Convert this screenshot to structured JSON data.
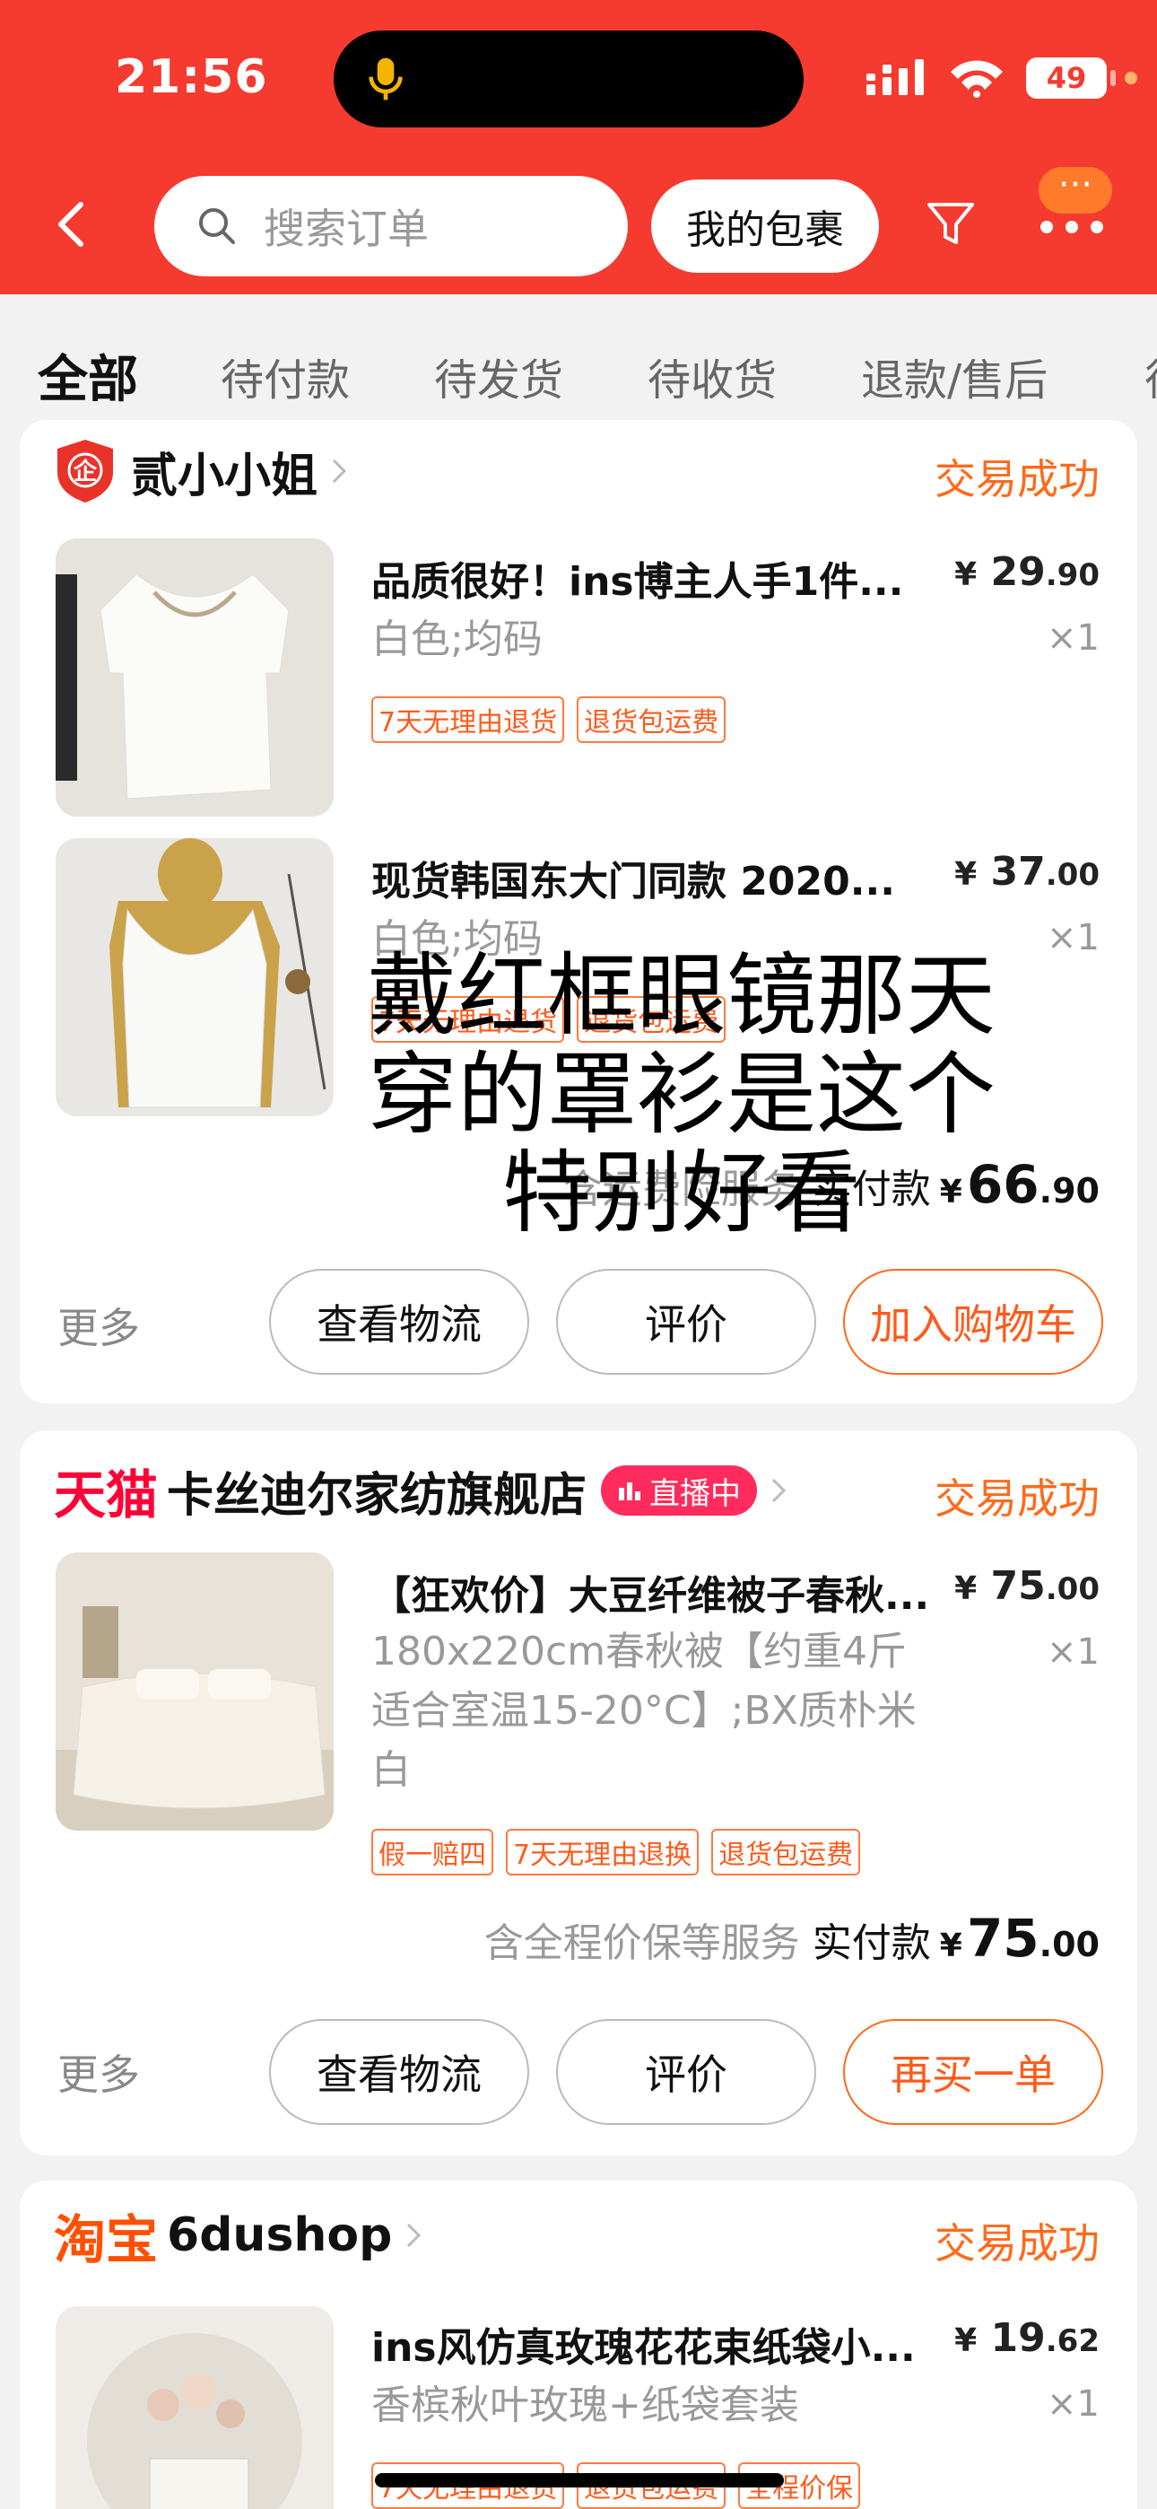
{
  "status_bar": {
    "time": "21:56",
    "battery": "49"
  },
  "header": {
    "search_placeholder": "搜索订单",
    "packages_label": "我的包裹"
  },
  "tabs": [
    "全部",
    "待付款",
    "待发货",
    "待收货",
    "退款/售后",
    "待"
  ],
  "orders": [
    {
      "shop": "贰小小姐",
      "status": "交易成功",
      "items": [
        {
          "title": "品质很好！ins博主人手1件...",
          "price_yen": "¥",
          "price_int": "29",
          "price_dec": ".90",
          "spec": "白色;均码",
          "qty": "×1",
          "tags": [
            "7天无理由退货",
            "退货包运费"
          ]
        },
        {
          "title": "现货韩国东大门同款 2020...",
          "price_yen": "¥",
          "price_int": "37",
          "price_dec": ".00",
          "spec": "白色;均码",
          "qty": "×1",
          "tags": [
            "7天无理由退货",
            "退货包运费"
          ]
        }
      ],
      "service": "含运费险服务",
      "paid_label": "实付款",
      "paid_yen": "¥",
      "paid_int": "66",
      "paid_dec": ".90",
      "more": "更多",
      "buttons": [
        "查看物流",
        "评价",
        "加入购物车"
      ]
    },
    {
      "brand": "天猫",
      "shop": "卡丝迪尔家纺旗舰店",
      "live": "直播中",
      "status": "交易成功",
      "items": [
        {
          "title": "【狂欢价】大豆纤维被子春秋...",
          "price_yen": "¥",
          "price_int": "75",
          "price_dec": ".00",
          "spec_lines": [
            "180x220cm春秋被【约重4斤",
            "适合室温15-20°C】;BX质朴米",
            "白"
          ],
          "qty": "×1",
          "tags": [
            "假一赔四",
            "7天无理由退换",
            "退货包运费"
          ]
        }
      ],
      "service": "含全程价保等服务",
      "paid_label": "实付款",
      "paid_yen": "¥",
      "paid_int": "75",
      "paid_dec": ".00",
      "more": "更多",
      "buttons": [
        "查看物流",
        "评价",
        "再买一单"
      ]
    },
    {
      "brand": "淘宝",
      "shop": "6dushop",
      "status": "交易成功",
      "items": [
        {
          "title": "ins风仿真玫瑰花花束纸袋小...",
          "price_yen": "¥",
          "price_int": "19",
          "price_dec": ".62",
          "spec": "香槟秋叶玫瑰+纸袋套装",
          "qty": "×1",
          "tags": [
            "7天无理由退货",
            "退货包运费",
            "全程价保"
          ]
        }
      ]
    }
  ],
  "overlay_caption": [
    "戴红框眼镜那天",
    "穿的罩衫是这个",
    "特别好看"
  ]
}
